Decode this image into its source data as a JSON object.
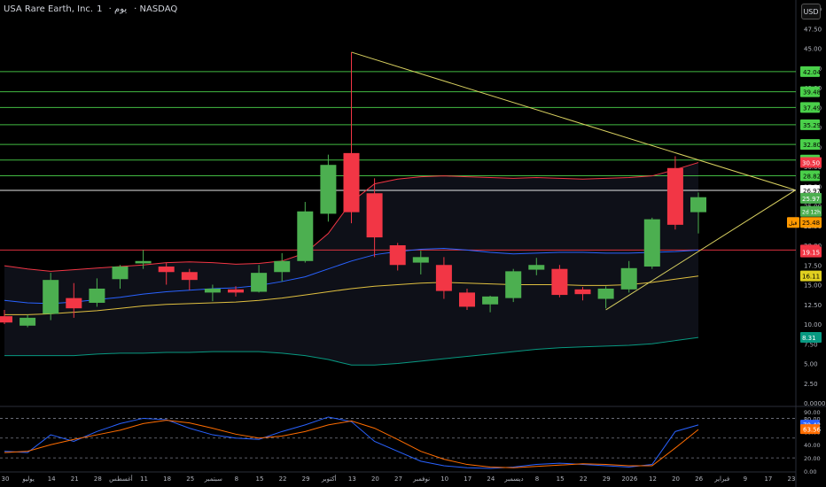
{
  "header": {
    "title": "USA Rare Earth, Inc.",
    "interval": "1",
    "period": "يوم",
    "exchange": "NASDAQ",
    "currency_button": "USD"
  },
  "colors": {
    "up": "#4caf50",
    "down": "#f23645",
    "bb_mid": "#f23645",
    "bb_upper": "#2962ff",
    "bb_lower": "#089981",
    "ma": "#e0c040",
    "trend": "#d8d060",
    "hline": "#4ad04a",
    "stoch_k": "#2962ff",
    "stoch_d": "#ff6d00"
  },
  "chart_data": {
    "type": "candlestick",
    "price_axis": {
      "min": 0,
      "max": 50,
      "ticks": [
        "50.00",
        "47.50",
        "45.00",
        "42.50",
        "40.00",
        "37.50",
        "35.00",
        "32.50",
        "30.00",
        "27.50",
        "25.00",
        "22.50",
        "20.00",
        "17.50",
        "15.00",
        "12.50",
        "10.00",
        "7.50",
        "5.00",
        "2.50",
        "0.0000"
      ]
    },
    "time_axis_labels": [
      "30",
      "يوليو",
      "14",
      "21",
      "28",
      "أغسطس",
      "11",
      "18",
      "25",
      "سبتمبر",
      "8",
      "15",
      "22",
      "29",
      "أكتوبر",
      "13",
      "20",
      "27",
      "نوفمبر",
      "10",
      "17",
      "24",
      "ديسمبر",
      "8",
      "15",
      "22",
      "29",
      "2026",
      "12",
      "20",
      "26",
      "فبراير",
      "9",
      "17",
      "23"
    ],
    "candles": [
      {
        "o": 11.0,
        "h": 11.8,
        "l": 10.0,
        "c": 10.2
      },
      {
        "o": 9.8,
        "h": 11.2,
        "l": 9.6,
        "c": 10.8
      },
      {
        "o": 11.3,
        "h": 16.5,
        "l": 10.5,
        "c": 15.6
      },
      {
        "o": 13.3,
        "h": 15.2,
        "l": 10.8,
        "c": 12.0
      },
      {
        "o": 12.7,
        "h": 15.8,
        "l": 12.2,
        "c": 14.5
      },
      {
        "o": 15.7,
        "h": 17.5,
        "l": 14.5,
        "c": 17.3
      },
      {
        "o": 17.7,
        "h": 19.4,
        "l": 17.0,
        "c": 18.0
      },
      {
        "o": 17.3,
        "h": 17.8,
        "l": 15.0,
        "c": 16.6
      },
      {
        "o": 16.6,
        "h": 17.0,
        "l": 14.3,
        "c": 15.6
      },
      {
        "o": 14.0,
        "h": 15.0,
        "l": 12.9,
        "c": 14.5
      },
      {
        "o": 14.4,
        "h": 14.8,
        "l": 13.5,
        "c": 14.0
      },
      {
        "o": 14.1,
        "h": 17.5,
        "l": 14.0,
        "c": 16.5
      },
      {
        "o": 16.6,
        "h": 19.0,
        "l": 15.4,
        "c": 18.0
      },
      {
        "o": 18.0,
        "h": 25.5,
        "l": 17.8,
        "c": 24.3
      },
      {
        "o": 24.0,
        "h": 31.5,
        "l": 23.0,
        "c": 30.2
      },
      {
        "o": 31.7,
        "h": 44.5,
        "l": 22.8,
        "c": 24.2
      },
      {
        "o": 26.6,
        "h": 28.5,
        "l": 18.5,
        "c": 21.0
      },
      {
        "o": 20.0,
        "h": 20.3,
        "l": 16.8,
        "c": 17.5
      },
      {
        "o": 17.8,
        "h": 19.3,
        "l": 16.3,
        "c": 18.5
      },
      {
        "o": 17.5,
        "h": 18.5,
        "l": 13.2,
        "c": 14.2
      },
      {
        "o": 14.0,
        "h": 14.5,
        "l": 11.8,
        "c": 12.2
      },
      {
        "o": 12.5,
        "h": 13.6,
        "l": 11.5,
        "c": 13.5
      },
      {
        "o": 13.3,
        "h": 17.0,
        "l": 12.8,
        "c": 16.7
      },
      {
        "o": 16.9,
        "h": 18.4,
        "l": 16.2,
        "c": 17.5
      },
      {
        "o": 17.0,
        "h": 17.5,
        "l": 13.4,
        "c": 13.7
      },
      {
        "o": 14.4,
        "h": 14.7,
        "l": 13.0,
        "c": 13.8
      },
      {
        "o": 13.2,
        "h": 14.8,
        "l": 12.0,
        "c": 14.5
      },
      {
        "o": 14.4,
        "h": 18.0,
        "l": 14.0,
        "c": 17.1
      },
      {
        "o": 17.3,
        "h": 23.5,
        "l": 17.0,
        "c": 23.3
      },
      {
        "o": 29.8,
        "h": 31.3,
        "l": 22.0,
        "c": 22.6
      },
      {
        "o": 24.2,
        "h": 26.7,
        "l": 21.5,
        "c": 26.1
      }
    ],
    "horizontal_levels": [
      {
        "value": 42.04,
        "label": "42.04",
        "color": "#4ad04a"
      },
      {
        "value": 39.48,
        "label": "39.48",
        "color": "#4ad04a"
      },
      {
        "value": 37.49,
        "label": "37.49",
        "color": "#4ad04a"
      },
      {
        "value": 35.29,
        "label": "35.29",
        "color": "#4ad04a"
      },
      {
        "value": 32.8,
        "label": "32.80",
        "color": "#4ad04a"
      },
      {
        "value": 30.81,
        "label": "30.81",
        "color": "#4ad04a"
      },
      {
        "value": 28.82,
        "label": "28.82",
        "color": "#4ad04a"
      },
      {
        "value": 26.97,
        "label": "26.97",
        "color": "#ffffff"
      },
      {
        "value": 19.4,
        "label": "19.40",
        "color": "#f23645"
      }
    ],
    "price_badges": [
      {
        "value": 30.5,
        "label": "30.50",
        "bg": "#f23645",
        "fg": "#ffffff"
      },
      {
        "value": 25.97,
        "label": "25.97",
        "bg": "#4caf50",
        "fg": "#ffffff"
      },
      {
        "value": 24.3,
        "label": "2d 12h",
        "bg": "#4caf50",
        "fg": "#ffffff"
      },
      {
        "value": 22.9,
        "label": "25.48",
        "bg": "#ff9800",
        "fg": "#000000",
        "prefix": "قبل"
      },
      {
        "value": 19.15,
        "label": "19.15",
        "bg": "#f23645",
        "fg": "#ffffff"
      },
      {
        "value": 16.11,
        "label": "16.11",
        "bg": "#e0d020",
        "fg": "#000000"
      },
      {
        "value": 8.31,
        "label": "8.31",
        "bg": "#089981",
        "fg": "#ffffff"
      }
    ],
    "trendline_upper": [
      {
        "i": 15,
        "v": 44.5
      },
      {
        "i": 34.2,
        "v": 27.0
      }
    ],
    "trendline_lower": [
      {
        "i": 26,
        "v": 11.8
      },
      {
        "i": 34.2,
        "v": 27.0
      }
    ],
    "bb_mid": [
      17.4,
      17.0,
      16.7,
      16.9,
      17.1,
      17.3,
      17.5,
      17.8,
      17.9,
      17.8,
      17.6,
      17.7,
      18.0,
      19.0,
      21.5,
      25.5,
      27.8,
      28.4,
      28.7,
      28.8,
      28.7,
      28.6,
      28.5,
      28.6,
      28.5,
      28.4,
      28.5,
      28.6,
      28.8,
      29.6,
      30.5
    ],
    "bb_upper": [
      13.0,
      12.7,
      12.6,
      12.8,
      13.1,
      13.4,
      13.8,
      14.1,
      14.3,
      14.5,
      14.6,
      14.9,
      15.4,
      16.0,
      17.0,
      18.0,
      18.8,
      19.2,
      19.5,
      19.6,
      19.4,
      19.1,
      18.9,
      19.0,
      19.1,
      19.1,
      19.0,
      19.0,
      19.1,
      19.2,
      19.4
    ],
    "bb_lower": [
      6.0,
      6.0,
      6.0,
      6.0,
      6.2,
      6.3,
      6.3,
      6.4,
      6.4,
      6.5,
      6.5,
      6.5,
      6.3,
      6.0,
      5.5,
      4.8,
      4.8,
      5.0,
      5.3,
      5.6,
      5.9,
      6.2,
      6.5,
      6.8,
      7.0,
      7.1,
      7.2,
      7.3,
      7.5,
      7.9,
      8.3
    ],
    "ma": [
      11.2,
      11.2,
      11.3,
      11.5,
      11.7,
      12.0,
      12.3,
      12.5,
      12.6,
      12.7,
      12.8,
      13.0,
      13.3,
      13.7,
      14.1,
      14.5,
      14.8,
      15.0,
      15.2,
      15.3,
      15.2,
      15.1,
      15.0,
      15.0,
      15.0,
      14.9,
      14.9,
      15.0,
      15.3,
      15.7,
      16.1
    ],
    "stochastic": {
      "min": 0,
      "max": 90,
      "ticks": [
        "90.00",
        "80.00",
        "60.00",
        "40.00",
        "20.00",
        "0.00"
      ],
      "levels": [
        80,
        50,
        20
      ],
      "k": [
        30,
        28,
        55,
        45,
        60,
        72,
        80,
        78,
        65,
        55,
        50,
        48,
        60,
        70,
        82,
        75,
        45,
        30,
        15,
        8,
        5,
        4,
        6,
        10,
        12,
        10,
        8,
        6,
        10,
        60,
        70
      ],
      "d": [
        28,
        30,
        40,
        48,
        55,
        62,
        72,
        77,
        73,
        65,
        56,
        50,
        53,
        60,
        70,
        76,
        65,
        48,
        30,
        18,
        10,
        6,
        5,
        7,
        9,
        11,
        10,
        8,
        8,
        35,
        63
      ],
      "badges": [
        {
          "value": 70.42,
          "label": "70.42",
          "bg": "#2962ff",
          "fg": "#ffffff"
        },
        {
          "value": 63.56,
          "label": "63.56",
          "bg": "#ff6d00",
          "fg": "#ffffff"
        }
      ]
    }
  }
}
